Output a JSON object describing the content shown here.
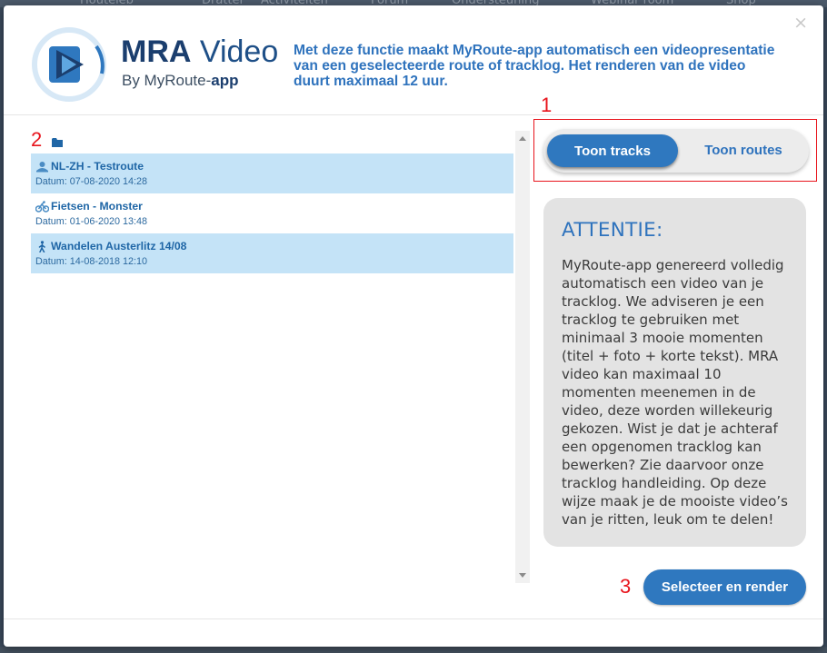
{
  "background_nav": [
    "Houteleb",
    "Drattel",
    "Activiteiten",
    "Forum",
    "Ondersteuning",
    "Webinar room",
    "Shop"
  ],
  "modal": {
    "close_label": "×",
    "logo": {
      "title_bold": "MRA",
      "title_rest": " Video",
      "subtitle_prefix": "By MyRoute-",
      "subtitle_bold": "app"
    },
    "intro_text": "Met deze functie maakt MyRoute-app automatisch een videopresentatie van een geselecteerde route of tracklog. Het renderen van de video duurt maximaal 12 uur."
  },
  "annotations": {
    "one": "1",
    "two": "2",
    "three": "3"
  },
  "list": {
    "folder_icon": "folder-icon",
    "items": [
      {
        "title": "NL-ZH - Testroute",
        "date": "Datum: 07-08-2020 14:28",
        "icon": "motorcycle-icon",
        "selected": true
      },
      {
        "title": "Fietsen - Monster",
        "date": "Datum: 01-06-2020 13:48",
        "icon": "bicycle-icon",
        "selected": false
      },
      {
        "title": "Wandelen Austerlitz 14/08",
        "date": "Datum: 14-08-2018 12:10",
        "icon": "walking-icon",
        "selected": true
      }
    ]
  },
  "toggle": {
    "tracks_label": "Toon tracks",
    "routes_label": "Toon routes",
    "active": "tracks"
  },
  "attention": {
    "title": "ATTENTIE:",
    "text": "MyRoute-app genereerd volledig automatisch een video van je tracklog. We adviseren je een tracklog te gebruiken met minimaal 3 mooie momenten (titel + foto + korte tekst). MRA video kan maximaal 10 momenten meenemen in de video, deze worden willekeurig gekozen. Wist je dat je achteraf een opgenomen tracklog kan bewerken? Zie daarvoor onze tracklog handleiding. Op deze wijze maak je de mooiste video’s van je ritten, leuk om te delen!"
  },
  "render_button_label": "Selecteer en render",
  "colors": {
    "accent": "#2f78bf",
    "selected_row": "#c4e3f7",
    "annotation": "#e8141c"
  }
}
